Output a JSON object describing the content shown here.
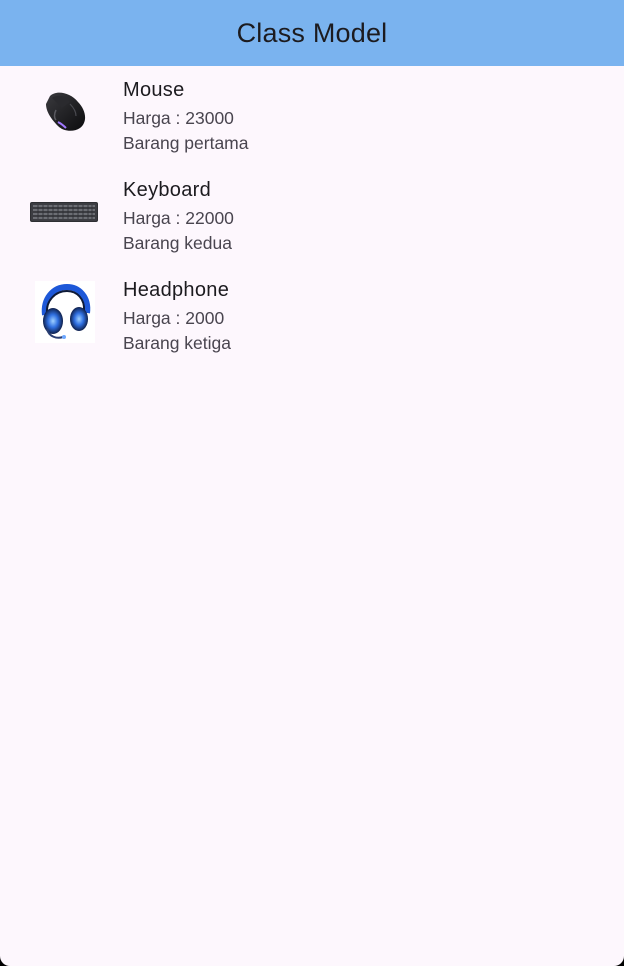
{
  "app_bar": {
    "title": "Class Model",
    "background": "#7ab3ef"
  },
  "items": [
    {
      "name": "Mouse",
      "price": "Harga : 23000",
      "description": "Barang pertama",
      "image_icon": "mouse-image"
    },
    {
      "name": "Keyboard",
      "price": "Harga : 22000",
      "description": "Barang kedua",
      "image_icon": "keyboard-image"
    },
    {
      "name": "Headphone",
      "price": "Harga : 2000",
      "description": "Barang ketiga",
      "image_icon": "headphone-image"
    }
  ]
}
